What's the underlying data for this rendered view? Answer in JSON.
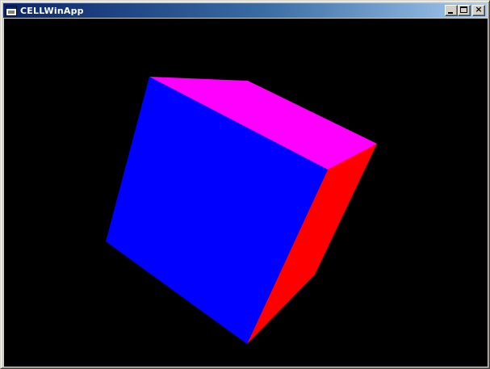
{
  "window": {
    "title": "CELLWinApp",
    "close_glyph": "×"
  },
  "icons": {
    "app": "application-icon",
    "minimize": "minimize-icon",
    "maximize": "maximize-icon",
    "close": "close-icon"
  },
  "scene": {
    "background": "#000000",
    "cube_faces": [
      {
        "name": "front-face",
        "color": "#0000ff"
      },
      {
        "name": "top-face",
        "color": "#ff00ff"
      },
      {
        "name": "side-face",
        "color": "#ff0000"
      }
    ]
  }
}
